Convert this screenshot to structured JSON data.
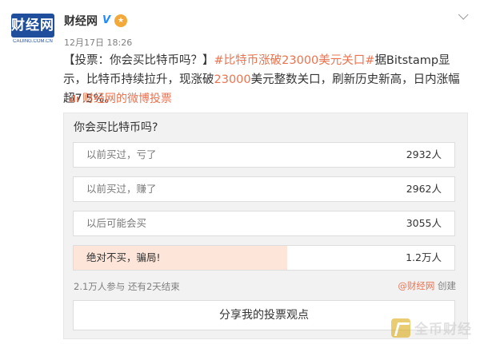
{
  "account": {
    "avatar_text": "财经网",
    "avatar_url_text": "CAIJING.COM.CN",
    "username": "财经网",
    "verified_icon": "verified-v-icon",
    "member_icon": "member-badge-icon"
  },
  "post": {
    "timestamp": "12月17日 18:26",
    "text_prefix": "【投票：你会买比特币吗？】",
    "hashtag": "#比特币涨破23000美元关口#",
    "text_mid1": "据Bitstamp显示，比特币持续拉升，现涨破",
    "number_highlight": "23000",
    "text_mid2": "美元整数关口，刷新历史新高，日内涨幅超7.5%。",
    "vote_link_label": "财经网的微博投票",
    "accent_color": "#eb7350"
  },
  "poll": {
    "question": "你会买比特币吗?",
    "options": [
      {
        "label": "以前买过，亏了",
        "count": "2932人"
      },
      {
        "label": "以前买过，赚了",
        "count": "2962人"
      },
      {
        "label": "以后可能会买",
        "count": "3055人"
      },
      {
        "label": "绝对不买，骗局!",
        "count": "1.2万人",
        "selected": true,
        "fill_fraction": 0.56
      }
    ],
    "stats": "2.1万人参与 还有2天结束",
    "creator_handle": "@财经网",
    "creator_suffix": "创建",
    "share_label": "分享我的投票观点",
    "fill_color": "#fde6d9"
  },
  "watermark": {
    "text": "全币财经"
  }
}
